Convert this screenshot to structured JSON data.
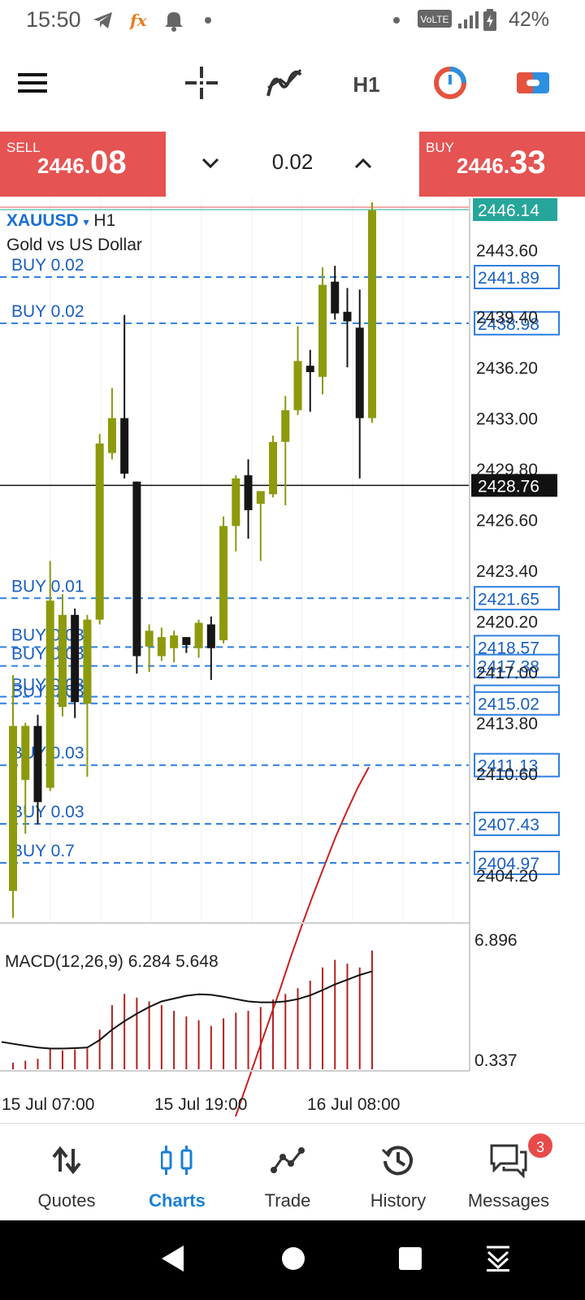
{
  "status_bar": {
    "time": "15:50",
    "network_badge": "VoLTE",
    "battery": "42%",
    "icons": [
      "telegram-icon",
      "app-fx-icon",
      "bell-icon",
      "dot-icon",
      "dot-icon",
      "signal-icon",
      "battery-icon"
    ]
  },
  "toolbar": {
    "timeframe": "H1",
    "icons": [
      "menu-icon",
      "crosshair-icon",
      "indicators-icon",
      "timer-icon",
      "toggle-icon"
    ]
  },
  "trade": {
    "sell_label": "SELL",
    "sell_price_small": "2446.",
    "sell_price_big": "08",
    "buy_label": "BUY",
    "buy_price_small": "2446.",
    "buy_price_big": "33",
    "lot": "0.02"
  },
  "chart": {
    "symbol": "XAUUSD",
    "symbol_arrow": "▾",
    "timeframe": "H1",
    "description": "Gold vs US Dollar",
    "current_price_tag": "2446.14",
    "crosshair_price_tag": "2428.76",
    "macd_label": "MACD(12,26,9) 6.284 5.648",
    "macd_max": "6.896",
    "macd_min": "0.337",
    "time_labels": [
      "15 Jul 07:00",
      "15 Jul 19:00",
      "16 Jul 08:00"
    ],
    "price_axis_labels": [
      "2443.60",
      "2439.40",
      "2436.20",
      "2433.00",
      "2429.80",
      "2426.60",
      "2423.40",
      "2420.20",
      "2417.00",
      "2413.80",
      "2410.60",
      "2404.20"
    ],
    "orders": [
      {
        "label": "BUY 0.02",
        "price": "2441.89"
      },
      {
        "label": "BUY 0.02",
        "price": "2438.98"
      },
      {
        "label": "BUY 0.01",
        "price": "2421.65"
      },
      {
        "label": "BUY 0.03",
        "price": "2418.57"
      },
      {
        "label": "BUY 0.03",
        "price": "2417.38"
      },
      {
        "label": "BUY 0.03",
        "price": "2415.44"
      },
      {
        "label": "BUY 0.03",
        "price": "2415.02"
      },
      {
        "label": "BUY 0.03",
        "price": "2411.13"
      },
      {
        "label": "BUY 0.03",
        "price": "2407.43"
      },
      {
        "label": "BUY 0.7",
        "price": "2404.97"
      }
    ],
    "candles": [
      {
        "o": 2403.2,
        "h": 2416.8,
        "l": 2401.5,
        "c": 2413.6
      },
      {
        "o": 2410.2,
        "h": 2413.8,
        "l": 2406.8,
        "c": 2413.6
      },
      {
        "o": 2413.6,
        "h": 2414.3,
        "l": 2407.4,
        "c": 2408.8
      },
      {
        "o": 2409.7,
        "h": 2424.0,
        "l": 2409.5,
        "c": 2421.5
      },
      {
        "o": 2414.8,
        "h": 2421.9,
        "l": 2414.2,
        "c": 2420.6
      },
      {
        "o": 2420.6,
        "h": 2421.0,
        "l": 2414.1,
        "c": 2415.1
      },
      {
        "o": 2415.0,
        "h": 2420.6,
        "l": 2410.4,
        "c": 2420.3
      },
      {
        "o": 2420.3,
        "h": 2432.0,
        "l": 2420.0,
        "c": 2431.4
      },
      {
        "o": 2430.8,
        "h": 2434.9,
        "l": 2430.4,
        "c": 2433.0
      },
      {
        "o": 2433.0,
        "h": 2439.5,
        "l": 2429.2,
        "c": 2429.5
      },
      {
        "o": 2429.0,
        "h": 2429.0,
        "l": 2416.9,
        "c": 2418.0
      },
      {
        "o": 2418.6,
        "h": 2420.0,
        "l": 2417.0,
        "c": 2419.6
      },
      {
        "o": 2418.0,
        "h": 2419.8,
        "l": 2417.7,
        "c": 2419.2
      },
      {
        "o": 2418.5,
        "h": 2419.6,
        "l": 2417.6,
        "c": 2419.3
      },
      {
        "o": 2419.2,
        "h": 2419.2,
        "l": 2418.2,
        "c": 2418.7
      },
      {
        "o": 2418.5,
        "h": 2420.3,
        "l": 2417.9,
        "c": 2420.1
      },
      {
        "o": 2420.0,
        "h": 2420.5,
        "l": 2416.5,
        "c": 2418.5
      },
      {
        "o": 2419.0,
        "h": 2426.8,
        "l": 2418.8,
        "c": 2426.2
      },
      {
        "o": 2426.2,
        "h": 2429.4,
        "l": 2424.6,
        "c": 2429.2
      },
      {
        "o": 2429.4,
        "h": 2430.4,
        "l": 2425.4,
        "c": 2427.2
      },
      {
        "o": 2427.6,
        "h": 2428.4,
        "l": 2424.0,
        "c": 2428.4
      },
      {
        "o": 2428.2,
        "h": 2431.9,
        "l": 2428.0,
        "c": 2431.5
      },
      {
        "o": 2431.5,
        "h": 2434.4,
        "l": 2427.5,
        "c": 2433.5
      },
      {
        "o": 2433.5,
        "h": 2438.8,
        "l": 2433.2,
        "c": 2436.6
      },
      {
        "o": 2436.3,
        "h": 2437.3,
        "l": 2433.4,
        "c": 2435.9
      },
      {
        "o": 2435.6,
        "h": 2442.5,
        "l": 2434.5,
        "c": 2441.4
      },
      {
        "o": 2441.6,
        "h": 2442.6,
        "l": 2439.2,
        "c": 2439.6
      },
      {
        "o": 2439.7,
        "h": 2441.2,
        "l": 2436.2,
        "c": 2439.1
      },
      {
        "o": 2438.7,
        "h": 2441.1,
        "l": 2429.2,
        "c": 2433.0
      },
      {
        "o": 2433.0,
        "h": 2446.6,
        "l": 2432.7,
        "c": 2446.1
      }
    ],
    "macd_hist": [
      0.35,
      0.45,
      0.55,
      1.1,
      1.0,
      1.05,
      1.1,
      2.1,
      3.4,
      4.0,
      3.8,
      3.6,
      3.4,
      3.1,
      2.8,
      2.6,
      2.3,
      2.7,
      3.0,
      3.1,
      3.3,
      3.7,
      4.0,
      4.3,
      4.7,
      5.4,
      5.8,
      5.6,
      5.4,
      6.3
    ],
    "macd_signal": [
      1.35,
      1.25,
      1.15,
      1.1,
      1.1,
      1.12,
      1.15,
      1.55,
      2.1,
      2.55,
      2.95,
      3.3,
      3.6,
      3.75,
      3.9,
      3.98,
      3.95,
      3.85,
      3.72,
      3.6,
      3.55,
      3.55,
      3.6,
      3.72,
      3.92,
      4.2,
      4.5,
      4.75,
      5.0,
      5.2
    ],
    "ma_points": [
      2377.0,
      2379.0,
      2381.0,
      2383.0,
      2385.0,
      2387.0,
      2389.0,
      2391.0,
      2393.0,
      2395.0,
      2397.0,
      2399.1,
      2401.1,
      2403.0,
      2404.8,
      2406.6,
      2408.2,
      2409.7,
      2411.0
    ],
    "colors": {
      "bull": "#8c9a0c",
      "bear": "#161616",
      "order_line": "#2f7fe0",
      "ma": "#cc1f1f",
      "macd_hist": "#b52020",
      "price_tag_current": "#26a69a",
      "sell_buy_button": "#e55353"
    }
  },
  "bottom_nav": {
    "items": [
      {
        "label": "Quotes",
        "icon": "quotes-icon"
      },
      {
        "label": "Charts",
        "icon": "charts-icon",
        "active": true
      },
      {
        "label": "Trade",
        "icon": "trade-icon"
      },
      {
        "label": "History",
        "icon": "history-icon"
      },
      {
        "label": "Messages",
        "icon": "messages-icon"
      }
    ],
    "messages_badge": "3"
  },
  "system_nav": {
    "icons": [
      "back-icon",
      "home-icon",
      "recents-icon",
      "notifications-down-icon"
    ]
  }
}
